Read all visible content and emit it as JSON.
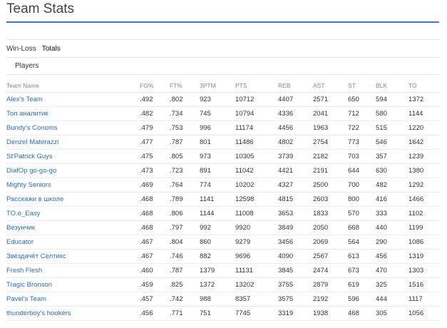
{
  "header": {
    "title": "Team Stats"
  },
  "tabs": [
    {
      "label": "Win-Loss",
      "active": false
    },
    {
      "label": "Totals",
      "active": true
    }
  ],
  "subtab": {
    "label": "Players"
  },
  "table": {
    "columns": [
      "Team Name",
      "FG%",
      "FT%",
      "3PTM",
      "PTS",
      "REB",
      "AST",
      "ST",
      "BLK",
      "TO"
    ],
    "rows": [
      [
        "Alex's Team",
        ".492",
        ".802",
        "923",
        "10712",
        "4407",
        "2571",
        "650",
        "594",
        "1372"
      ],
      [
        "Топ аналитик",
        ".482",
        ".734",
        "745",
        "10794",
        "4336",
        "2041",
        "712",
        "580",
        "1144"
      ],
      [
        "Bundy's Conoms",
        ".479",
        ".753",
        "996",
        "11174",
        "4456",
        "1963",
        "722",
        "515",
        "1220"
      ],
      [
        "Denzel Materazzi",
        ".477",
        ".787",
        "801",
        "11486",
        "4802",
        "2754",
        "773",
        "546",
        "1642"
      ],
      [
        "St'Patrick Guys",
        ".475",
        ".805",
        "973",
        "10305",
        "3739",
        "2182",
        "703",
        "357",
        "1239"
      ],
      [
        "DiafOp go-go-go",
        ".473",
        ".723",
        "891",
        "11042",
        "4421",
        "2191",
        "644",
        "630",
        "1380"
      ],
      [
        "Mighty Seniors",
        ".469",
        ".764",
        "774",
        "10202",
        "4327",
        "2500",
        "700",
        "482",
        "1292"
      ],
      [
        "Расскажи в школе",
        ".468",
        ".789",
        "1141",
        "12598",
        "4815",
        "2603",
        "800",
        "416",
        "1466"
      ],
      [
        "TO.o_Easy",
        ".468",
        ".806",
        "1144",
        "11008",
        "3653",
        "1833",
        "570",
        "333",
        "1102"
      ],
      [
        "Везунчик",
        ".468",
        ".797",
        "992",
        "9920",
        "3849",
        "2050",
        "668",
        "440",
        "1199"
      ],
      [
        "Educator",
        ".467",
        ".804",
        "860",
        "9279",
        "3456",
        "2069",
        "564",
        "290",
        "1086"
      ],
      [
        "Звездачёт Селтикс",
        ".467",
        ".746",
        "882",
        "9696",
        "4090",
        "2567",
        "613",
        "456",
        "1319"
      ],
      [
        "Fresh Flesh",
        ".460",
        ".787",
        "1379",
        "11131",
        "3845",
        "2474",
        "673",
        "470",
        "1303"
      ],
      [
        "Tragic Bronson",
        ".459",
        ".825",
        "1372",
        "13202",
        "3755",
        "2879",
        "619",
        "325",
        "1516"
      ],
      [
        "Pavel's Team",
        ".457",
        ".742",
        "988",
        "8357",
        "3575",
        "2192",
        "596",
        "444",
        "1117"
      ],
      [
        "thunderboy's hookers",
        ".456",
        ".771",
        "751",
        "7745",
        "3319",
        "1938",
        "468",
        "305",
        "1056"
      ]
    ]
  }
}
